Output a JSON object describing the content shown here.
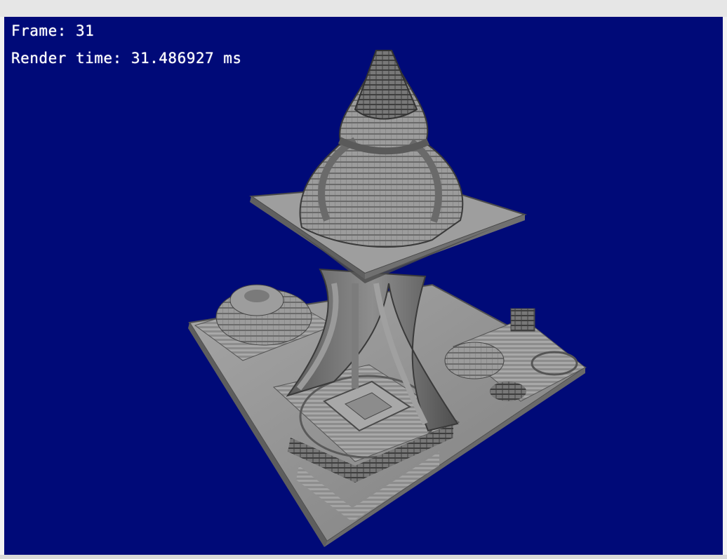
{
  "hud": {
    "frame_label": "Frame: 31",
    "render_label": "Render time: 31.486927 ms"
  },
  "colors": {
    "background": "#000a78",
    "stone_light": "#9a9a9a",
    "stone_mid": "#7a7a7a",
    "stone_dark": "#555555",
    "text": "#ffffff"
  },
  "scene": {
    "icon": "voxel-temple-render"
  }
}
